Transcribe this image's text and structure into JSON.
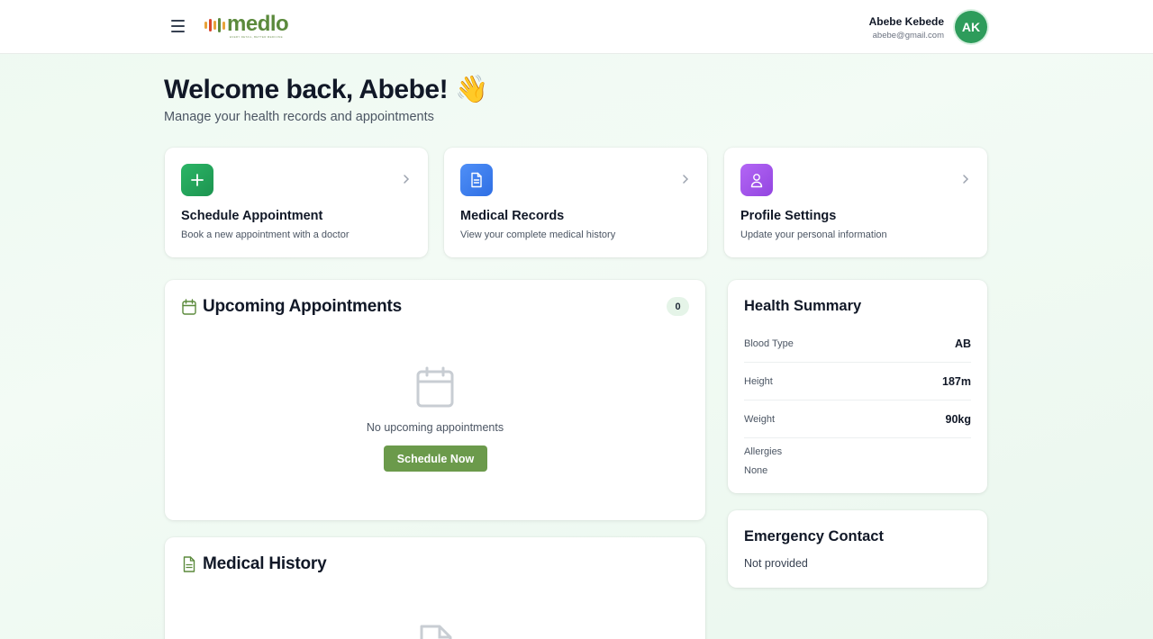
{
  "header": {
    "logo_text": "medlo",
    "logo_tagline": "EVERY DETAIL, BETTER MEDICINE",
    "user_name": "Abebe Kebede",
    "user_email": "abebe@gmail.com",
    "avatar_initials": "AK"
  },
  "welcome": {
    "title": "Welcome back, Abebe! 👋",
    "subtitle": "Manage your health records and appointments"
  },
  "actions": [
    {
      "title": "Schedule Appointment",
      "description": "Book a new appointment with a doctor",
      "icon": "plus-icon",
      "color": "#22a35a"
    },
    {
      "title": "Medical Records",
      "description": "View your complete medical history",
      "icon": "document-icon",
      "color": "#3b82f6"
    },
    {
      "title": "Profile Settings",
      "description": "Update your personal information",
      "icon": "user-icon",
      "color": "#a855f7"
    }
  ],
  "appointments": {
    "title": "Upcoming Appointments",
    "count": "0",
    "empty_text": "No upcoming appointments",
    "button_label": "Schedule Now"
  },
  "medical_history": {
    "title": "Medical History"
  },
  "health_summary": {
    "title": "Health Summary",
    "rows": [
      {
        "label": "Blood Type",
        "value": "AB"
      },
      {
        "label": "Height",
        "value": "187m"
      },
      {
        "label": "Weight",
        "value": "90kg"
      }
    ],
    "allergies_label": "Allergies",
    "allergies_value": "None"
  },
  "emergency_contact": {
    "title": "Emergency Contact",
    "value": "Not provided"
  },
  "colors": {
    "brand": "#5b8a3c",
    "primary_button": "#6b9a4b",
    "accent_green": "#2e9c5b"
  }
}
